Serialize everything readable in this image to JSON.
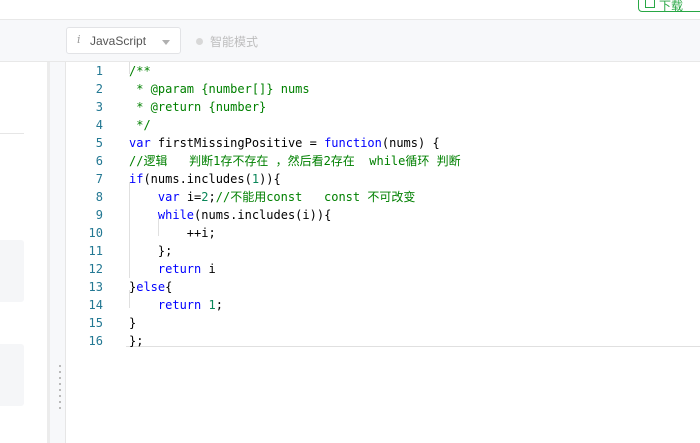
{
  "header": {
    "download_label": "下载"
  },
  "toolbar": {
    "info_glyph": "i",
    "language": "JavaScript",
    "smart_mode_label": "智能模式"
  },
  "editor": {
    "lines": [
      {
        "n": "1",
        "tokens": [
          {
            "t": "/**",
            "c": "cm"
          }
        ]
      },
      {
        "n": "2",
        "tokens": [
          {
            "t": " * @param {number[]} nums",
            "c": "cm"
          }
        ]
      },
      {
        "n": "3",
        "tokens": [
          {
            "t": " * @return {number}",
            "c": "cm"
          }
        ]
      },
      {
        "n": "4",
        "tokens": [
          {
            "t": " */",
            "c": "cm"
          }
        ]
      },
      {
        "n": "5",
        "tokens": [
          {
            "t": "var",
            "c": "kw"
          },
          {
            "t": " firstMissingPositive = ",
            "c": ""
          },
          {
            "t": "function",
            "c": "kw"
          },
          {
            "t": "(nums) {",
            "c": ""
          }
        ]
      },
      {
        "n": "6",
        "tokens": [
          {
            "t": "//逻辑   判断1存不存在 ，然后看2存在  while循环 判断",
            "c": "cm"
          }
        ]
      },
      {
        "n": "7",
        "tokens": [
          {
            "t": "if",
            "c": "kw"
          },
          {
            "t": "(nums.includes(",
            "c": ""
          },
          {
            "t": "1",
            "c": "num"
          },
          {
            "t": ")){",
            "c": ""
          }
        ]
      },
      {
        "n": "8",
        "tokens": [
          {
            "t": "    ",
            "c": ""
          },
          {
            "t": "var",
            "c": "kw"
          },
          {
            "t": " i=",
            "c": ""
          },
          {
            "t": "2",
            "c": "num"
          },
          {
            "t": ";",
            "c": ""
          },
          {
            "t": "//不能用const   const 不可改变",
            "c": "cm"
          }
        ]
      },
      {
        "n": "9",
        "tokens": [
          {
            "t": "    ",
            "c": ""
          },
          {
            "t": "while",
            "c": "kw"
          },
          {
            "t": "(nums.includes(i)){",
            "c": ""
          }
        ]
      },
      {
        "n": "10",
        "tokens": [
          {
            "t": "        ++i;",
            "c": ""
          }
        ]
      },
      {
        "n": "11",
        "tokens": [
          {
            "t": "    };",
            "c": ""
          }
        ]
      },
      {
        "n": "12",
        "tokens": [
          {
            "t": "    ",
            "c": ""
          },
          {
            "t": "return",
            "c": "kw"
          },
          {
            "t": " i",
            "c": ""
          }
        ]
      },
      {
        "n": "13",
        "tokens": [
          {
            "t": "}",
            "c": ""
          },
          {
            "t": "else",
            "c": "kw"
          },
          {
            "t": "{",
            "c": ""
          }
        ]
      },
      {
        "n": "14",
        "tokens": [
          {
            "t": "    ",
            "c": ""
          },
          {
            "t": "return",
            "c": "kw"
          },
          {
            "t": " ",
            "c": ""
          },
          {
            "t": "1",
            "c": "num"
          },
          {
            "t": ";",
            "c": ""
          }
        ]
      },
      {
        "n": "15",
        "tokens": [
          {
            "t": "}",
            "c": ""
          }
        ]
      },
      {
        "n": "16",
        "tokens": [
          {
            "t": "};",
            "c": ""
          }
        ]
      }
    ]
  },
  "colors": {
    "line_number": "#237893",
    "comment": "#008000",
    "keyword": "#0000ff",
    "number": "#098658",
    "accent_green": "#28a745"
  }
}
